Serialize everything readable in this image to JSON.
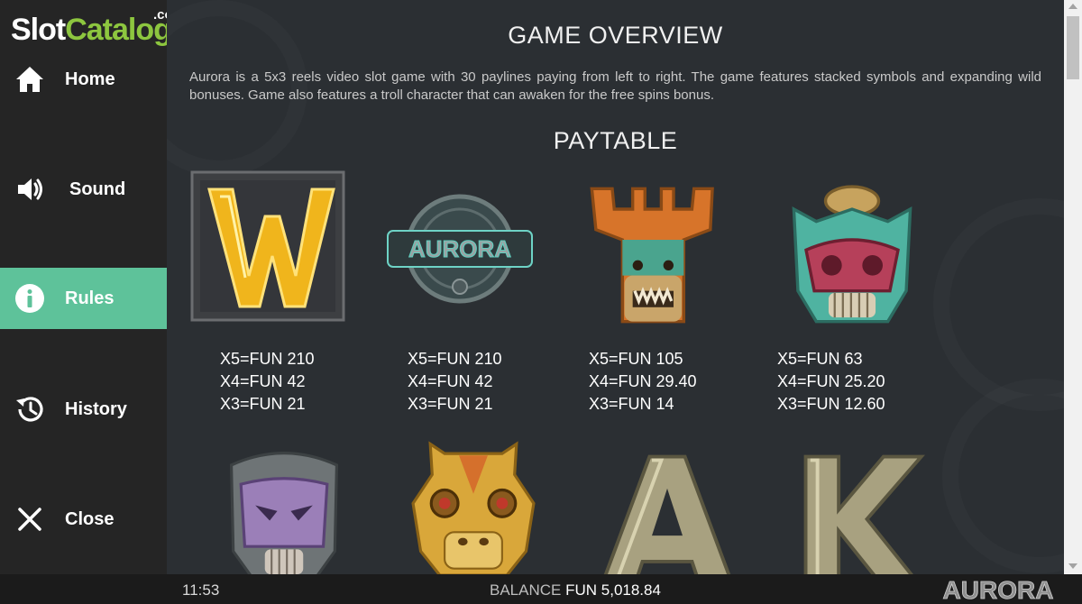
{
  "logo": {
    "slot": "Slot",
    "catalog": "Catalog",
    "com": ".com"
  },
  "nav": [
    {
      "label": "Home",
      "icon": "home-icon"
    },
    {
      "label": "Sound",
      "icon": "speaker-icon"
    },
    {
      "label": "Rules",
      "icon": "info-icon",
      "active": true
    },
    {
      "label": "History",
      "icon": "history-icon"
    },
    {
      "label": "Close",
      "icon": "close-icon"
    }
  ],
  "overview": {
    "title": "GAME OVERVIEW",
    "text": "Aurora is a 5x3 reels video slot game with 30 paylines paying from left to right. The game features stacked symbols and expanding wild bonuses. Game also features a troll character that can awaken for the free spins bonus."
  },
  "paytable": {
    "title": "PAYTABLE",
    "symbols": [
      {
        "name": "wild-symbol",
        "payouts": [
          "X5=FUN 210",
          "X4=FUN 42",
          "X3=FUN 21"
        ]
      },
      {
        "name": "aurora-logo-symbol",
        "payouts": [
          "X5=FUN 210",
          "X4=FUN 42",
          "X3=FUN 21"
        ]
      },
      {
        "name": "orange-mask-symbol",
        "payouts": [
          "X5=FUN 105",
          "X4=FUN 29.40",
          "X3=FUN 14"
        ]
      },
      {
        "name": "teal-mask-symbol",
        "payouts": [
          "X5=FUN 63",
          "X4=FUN 25.20",
          "X3=FUN 12.60"
        ]
      },
      {
        "name": "purple-mask-symbol"
      },
      {
        "name": "gold-mask-symbol"
      },
      {
        "name": "letter-a-symbol",
        "letter": "A"
      },
      {
        "name": "letter-k-symbol",
        "letter": "K"
      }
    ]
  },
  "status": {
    "time": "11:53",
    "balance_label": "BALANCE",
    "balance_value": "FUN 5,018.84",
    "brand": "AURORA"
  },
  "colors": {
    "accent": "#5ec29a",
    "sidebar": "#252525",
    "content_bg": "#2b2f33",
    "logo_green": "#8dc63f"
  }
}
